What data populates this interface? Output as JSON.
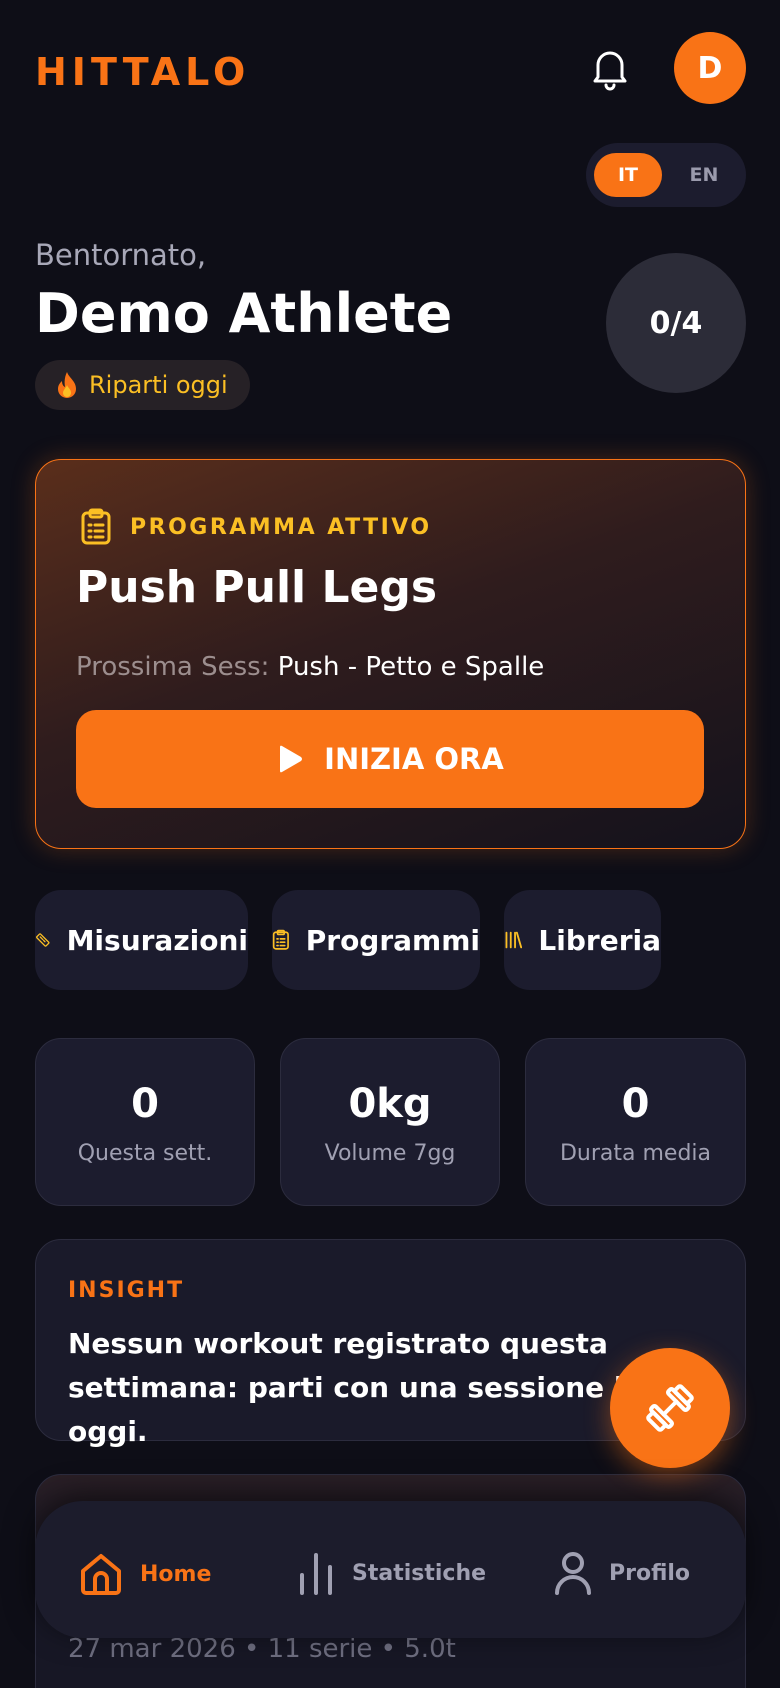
{
  "header": {
    "logo": "HITTALO",
    "avatar_initial": "D"
  },
  "language": {
    "options": [
      "IT",
      "EN"
    ],
    "selected": "IT"
  },
  "greeting": {
    "welcome": "Bentornato,",
    "name": "Demo Athlete",
    "streak": "Riparti oggi",
    "progress": "0/4"
  },
  "program": {
    "label": "PROGRAMMA ATTIVO",
    "title": "Push Pull Legs",
    "next_label": "Prossima Sess:",
    "next_value": "Push - Petto e Spalle",
    "start_label": "INIZIA ORA"
  },
  "quick_links": [
    {
      "label": "Misurazioni",
      "icon": "ruler-icon"
    },
    {
      "label": "Programmi",
      "icon": "clipboard-icon"
    },
    {
      "label": "Libreria",
      "icon": "library-icon"
    }
  ],
  "stats": [
    {
      "value": "0",
      "label": "Questa sett."
    },
    {
      "value": "0kg",
      "label": "Volume 7gg"
    },
    {
      "value": "0",
      "label": "Durata media"
    }
  ],
  "insight": {
    "title": "INSIGHT",
    "text": "Nessun workout registrato questa settimana: parti con una sessione breve oggi."
  },
  "history": {
    "meta": "27 mar 2026 • 11 serie • 5.0t"
  },
  "nav": {
    "items": [
      {
        "label": "Home",
        "icon": "home-icon",
        "active": true
      },
      {
        "label": "Statistiche",
        "icon": "stats-icon",
        "active": false
      },
      {
        "label": "Profilo",
        "icon": "profile-icon",
        "active": false
      }
    ]
  },
  "colors": {
    "accent": "#f97316",
    "background": "#0e0e17",
    "card": "#1c1c2e",
    "highlight": "#fbbf24"
  }
}
